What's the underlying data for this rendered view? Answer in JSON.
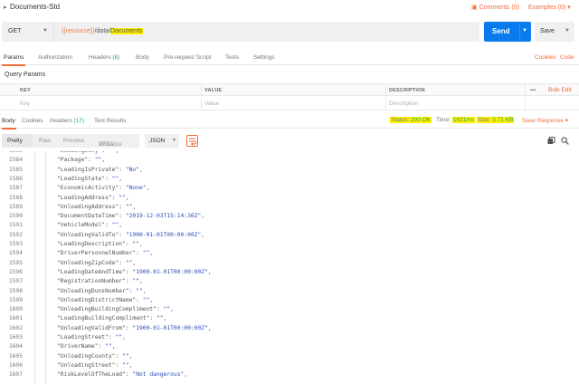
{
  "tab_title": "Documents-Std",
  "header": {
    "comments": "Comments (0)",
    "examples": "Examples (0)"
  },
  "request": {
    "method": "GET",
    "url_var": "{{resource}}",
    "url_path": "/data/",
    "url_highlight": "Documents",
    "send_label": "Send",
    "save_label": "Save"
  },
  "request_tabs": [
    {
      "label": "Params",
      "active": true
    },
    {
      "label": "Authorization"
    },
    {
      "label": "Headers",
      "count": "(8)"
    },
    {
      "label": "Body"
    },
    {
      "label": "Pre-request Script"
    },
    {
      "label": "Tests"
    },
    {
      "label": "Settings"
    }
  ],
  "links": {
    "cookies": "Cookies",
    "code": "Code",
    "bulk_edit": "Bulk Edit",
    "more": "•••"
  },
  "query_params": {
    "title": "Query Params",
    "columns": [
      "KEY",
      "VALUE",
      "DESCRIPTION"
    ],
    "placeholders": {
      "key": "Key",
      "value": "Value",
      "description": "Description"
    }
  },
  "response_tabs": [
    {
      "label": "Body",
      "active": true
    },
    {
      "label": "Cookies"
    },
    {
      "label": "Headers",
      "count": "(17)"
    },
    {
      "label": "Test Results"
    }
  ],
  "response_meta": {
    "status_label": "Status:",
    "status_value": "200 OK",
    "time_label": "Time:",
    "time_value": "1621ms",
    "size_label": "Size:",
    "size_value": "5.71 KB",
    "save_response": "Save Response"
  },
  "view_modes": [
    "Pretty",
    "Raw",
    "Preview",
    "Visualize"
  ],
  "beta_label": "BETA",
  "format": "JSON",
  "code_lines": [
    {
      "n": "1583",
      "k": "\"LoadingDuty\"",
      "v": "\"\"",
      "t": "str",
      "partial": true
    },
    {
      "n": "1584",
      "k": "\"Package\"",
      "v": "\"\"",
      "t": "str"
    },
    {
      "n": "1585",
      "k": "\"LoadingIsPrivate\"",
      "v": "\"No\"",
      "t": "str"
    },
    {
      "n": "1586",
      "k": "\"LoadingState\"",
      "v": "\"\"",
      "t": "str"
    },
    {
      "n": "1587",
      "k": "\"EconomicActivity\"",
      "v": "\"None\"",
      "t": "str"
    },
    {
      "n": "1588",
      "k": "\"LoadingAddress\"",
      "v": "\"\"",
      "t": "str"
    },
    {
      "n": "1589",
      "k": "\"UnloadingAddress\"",
      "v": "\"\"",
      "t": "str"
    },
    {
      "n": "1590",
      "k": "\"DocumentDateTime\"",
      "v": "\"2019-12-03T15:14:36Z\"",
      "t": "str"
    },
    {
      "n": "1591",
      "k": "\"VehicleModel\"",
      "v": "\"\"",
      "t": "str"
    },
    {
      "n": "1592",
      "k": "\"UnloadingValidTo\"",
      "v": "\"1900-01-01T00:00:00Z\"",
      "t": "str"
    },
    {
      "n": "1593",
      "k": "\"LoadingDescription\"",
      "v": "\"\"",
      "t": "str"
    },
    {
      "n": "1594",
      "k": "\"DriverPersonnelNumber\"",
      "v": "\"\"",
      "t": "str"
    },
    {
      "n": "1595",
      "k": "\"UnloadingZipCode\"",
      "v": "\"\"",
      "t": "str"
    },
    {
      "n": "1596",
      "k": "\"LoadingDateAndTime\"",
      "v": "\"1900-01-01T00:00:00Z\"",
      "t": "str"
    },
    {
      "n": "1597",
      "k": "\"RegistrationNumber\"",
      "v": "\"\"",
      "t": "str"
    },
    {
      "n": "1598",
      "k": "\"UnloadingDunsNumber\"",
      "v": "\"\"",
      "t": "str"
    },
    {
      "n": "1599",
      "k": "\"UnloadingDistrictName\"",
      "v": "\"\"",
      "t": "str"
    },
    {
      "n": "1600",
      "k": "\"UnloadingBuildingCompliment\"",
      "v": "\"\"",
      "t": "str"
    },
    {
      "n": "1601",
      "k": "\"LoadingBuildingCompliment\"",
      "v": "\"\"",
      "t": "str"
    },
    {
      "n": "1602",
      "k": "\"UnloadingValidFrom\"",
      "v": "\"1900-01-01T00:00:00Z\"",
      "t": "str"
    },
    {
      "n": "1603",
      "k": "\"LoadingStreet\"",
      "v": "\"\"",
      "t": "str"
    },
    {
      "n": "1604",
      "k": "\"DriverName\"",
      "v": "\"\"",
      "t": "str"
    },
    {
      "n": "1605",
      "k": "\"UnloadingCounty\"",
      "v": "\"\"",
      "t": "str"
    },
    {
      "n": "1606",
      "k": "\"UnloadingStreet\"",
      "v": "\"\"",
      "t": "str"
    },
    {
      "n": "1607",
      "k": "\"RiskLevelOfTheLoad\"",
      "v": "\"Not dangerous\"",
      "t": "str"
    }
  ],
  "colors": {
    "accent": "#f26b3a",
    "send": "#097bed",
    "highlight": "#ffee00",
    "status_ok": "#2aa56b",
    "json_value": "#2a4cb5"
  }
}
